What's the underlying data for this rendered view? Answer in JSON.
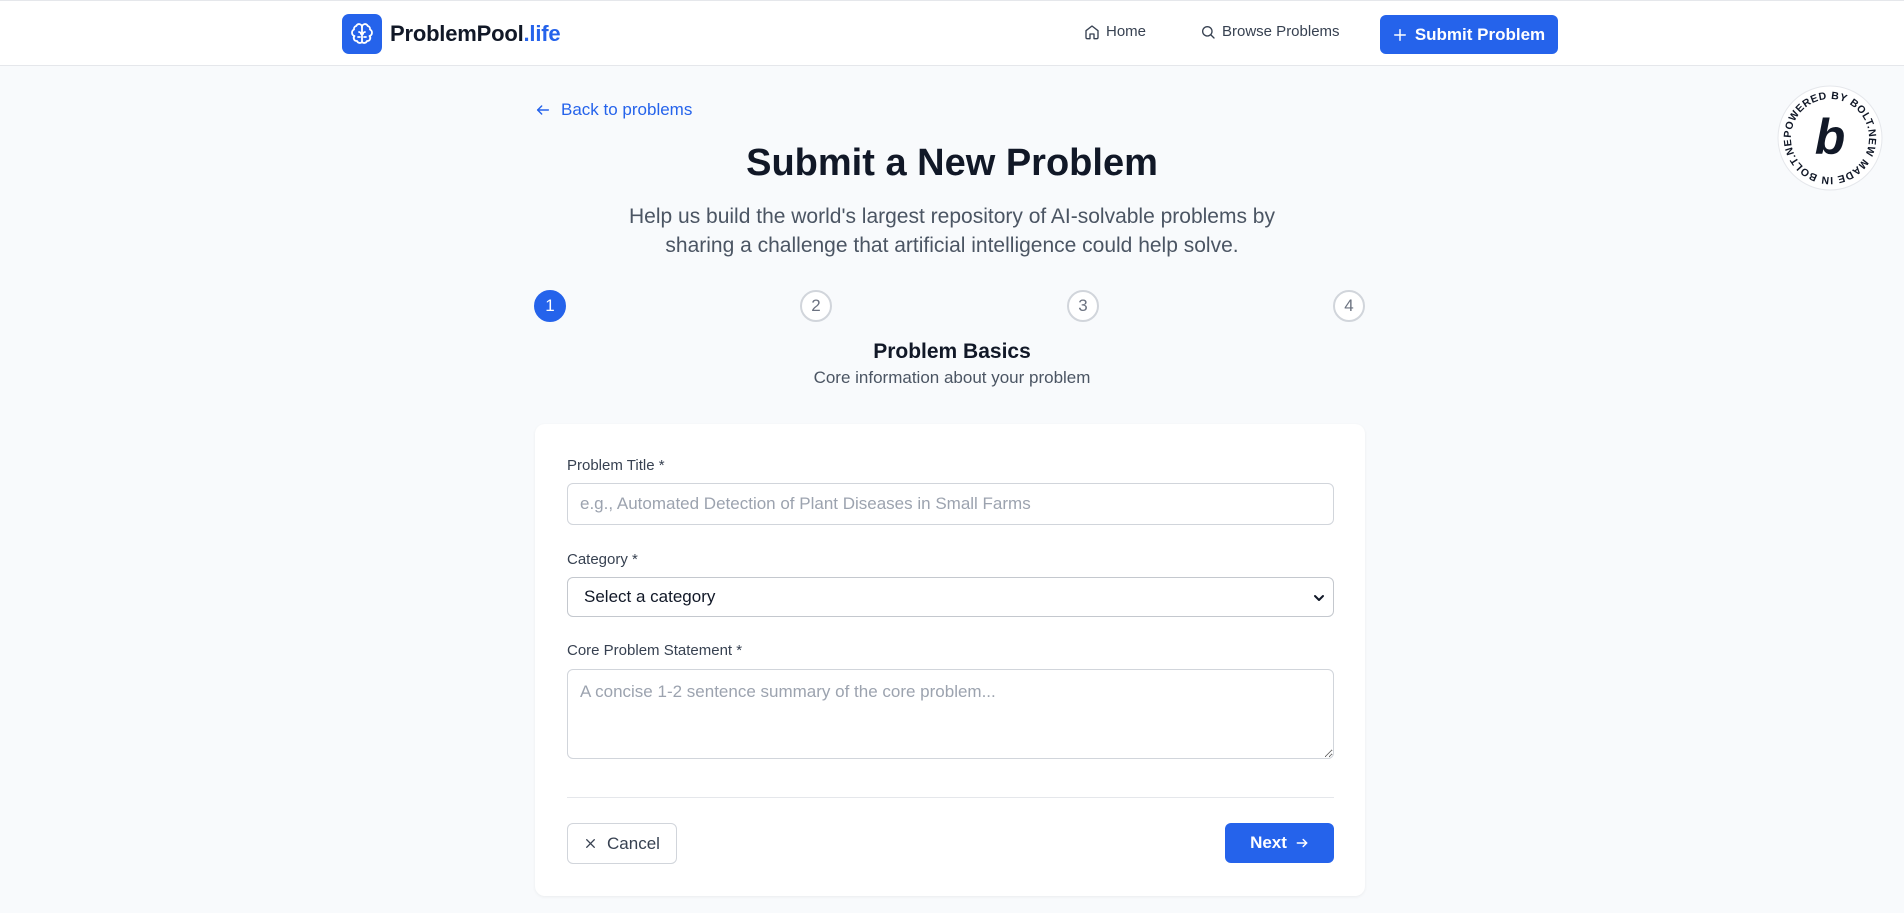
{
  "header": {
    "logo_name": "ProblemPool",
    "logo_tld": ".life",
    "logo_icon": "brain-icon",
    "nav": {
      "home_label": "Home",
      "home_icon": "home-icon",
      "browse_label": "Browse Problems",
      "browse_icon": "search-icon"
    },
    "submit_label": "Submit Problem",
    "submit_icon": "plus-icon"
  },
  "badge": {
    "ring_text": "POWERED BY BOLT.NEW MADE IN BOLT.NEW",
    "letter": "b"
  },
  "back_link": {
    "label": "Back to problems",
    "icon": "arrow-left-icon"
  },
  "page": {
    "title": "Submit a New Problem",
    "subtitle": "Help us build the world's largest repository of AI-solvable problems by sharing a challenge that artificial intelligence could help solve."
  },
  "steps": {
    "items": [
      "1",
      "2",
      "3",
      "4"
    ],
    "active": 1,
    "current_title": "Problem Basics",
    "current_desc": "Core information about your problem"
  },
  "form": {
    "title_label": "Problem Title *",
    "title_placeholder": "e.g., Automated Detection of Plant Diseases in Small Farms",
    "title_value": "",
    "category_label": "Category *",
    "category_selected": "Select a category",
    "statement_label": "Core Problem Statement *",
    "statement_placeholder": "A concise 1-2 sentence summary of the core problem...",
    "statement_value": "",
    "cancel_label": "Cancel",
    "cancel_icon": "close-icon",
    "next_label": "Next",
    "next_icon": "arrow-right-icon"
  },
  "colors": {
    "accent": "#2563eb",
    "background": "#f8fafc",
    "text": "#111827",
    "muted": "#4b5563"
  }
}
